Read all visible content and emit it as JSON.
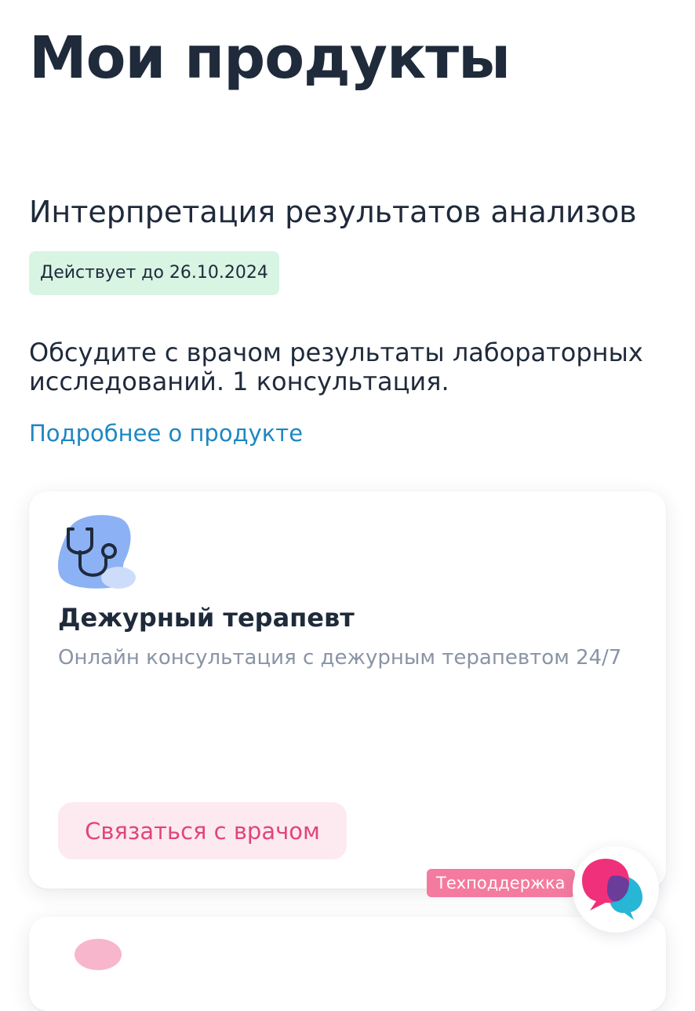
{
  "page": {
    "title": "Мои продукты"
  },
  "product": {
    "name": "Интерпретация результатов анализов",
    "validity": "Действует до 26.10.2024",
    "description": "Обсудите с врачом результаты лабораторных исследований. 1 консультация.",
    "more_link": "Подробнее о продукте"
  },
  "service_card": {
    "icon": "stethoscope-icon",
    "title": "Дежурный терапевт",
    "subtitle": "Онлайн консультация с дежурным терапевтом 24/7",
    "button_label": "Связаться с врачом"
  },
  "support": {
    "label": "Техподдержка",
    "icon": "chat-bubbles-icon"
  },
  "colors": {
    "title_text": "#1f2a3b",
    "badge_bg": "#d8f4e3",
    "link": "#1e87c2",
    "subtitle_text": "#8a94a6",
    "button_bg": "#fdeaf1",
    "button_text": "#e0457b",
    "support_label_bg": "#f57aa0",
    "icon_blob_blue": "#8cb2f5",
    "support_pink": "#f0307a",
    "support_cyan": "#27b6d6",
    "support_purple": "#6a3d9a"
  }
}
